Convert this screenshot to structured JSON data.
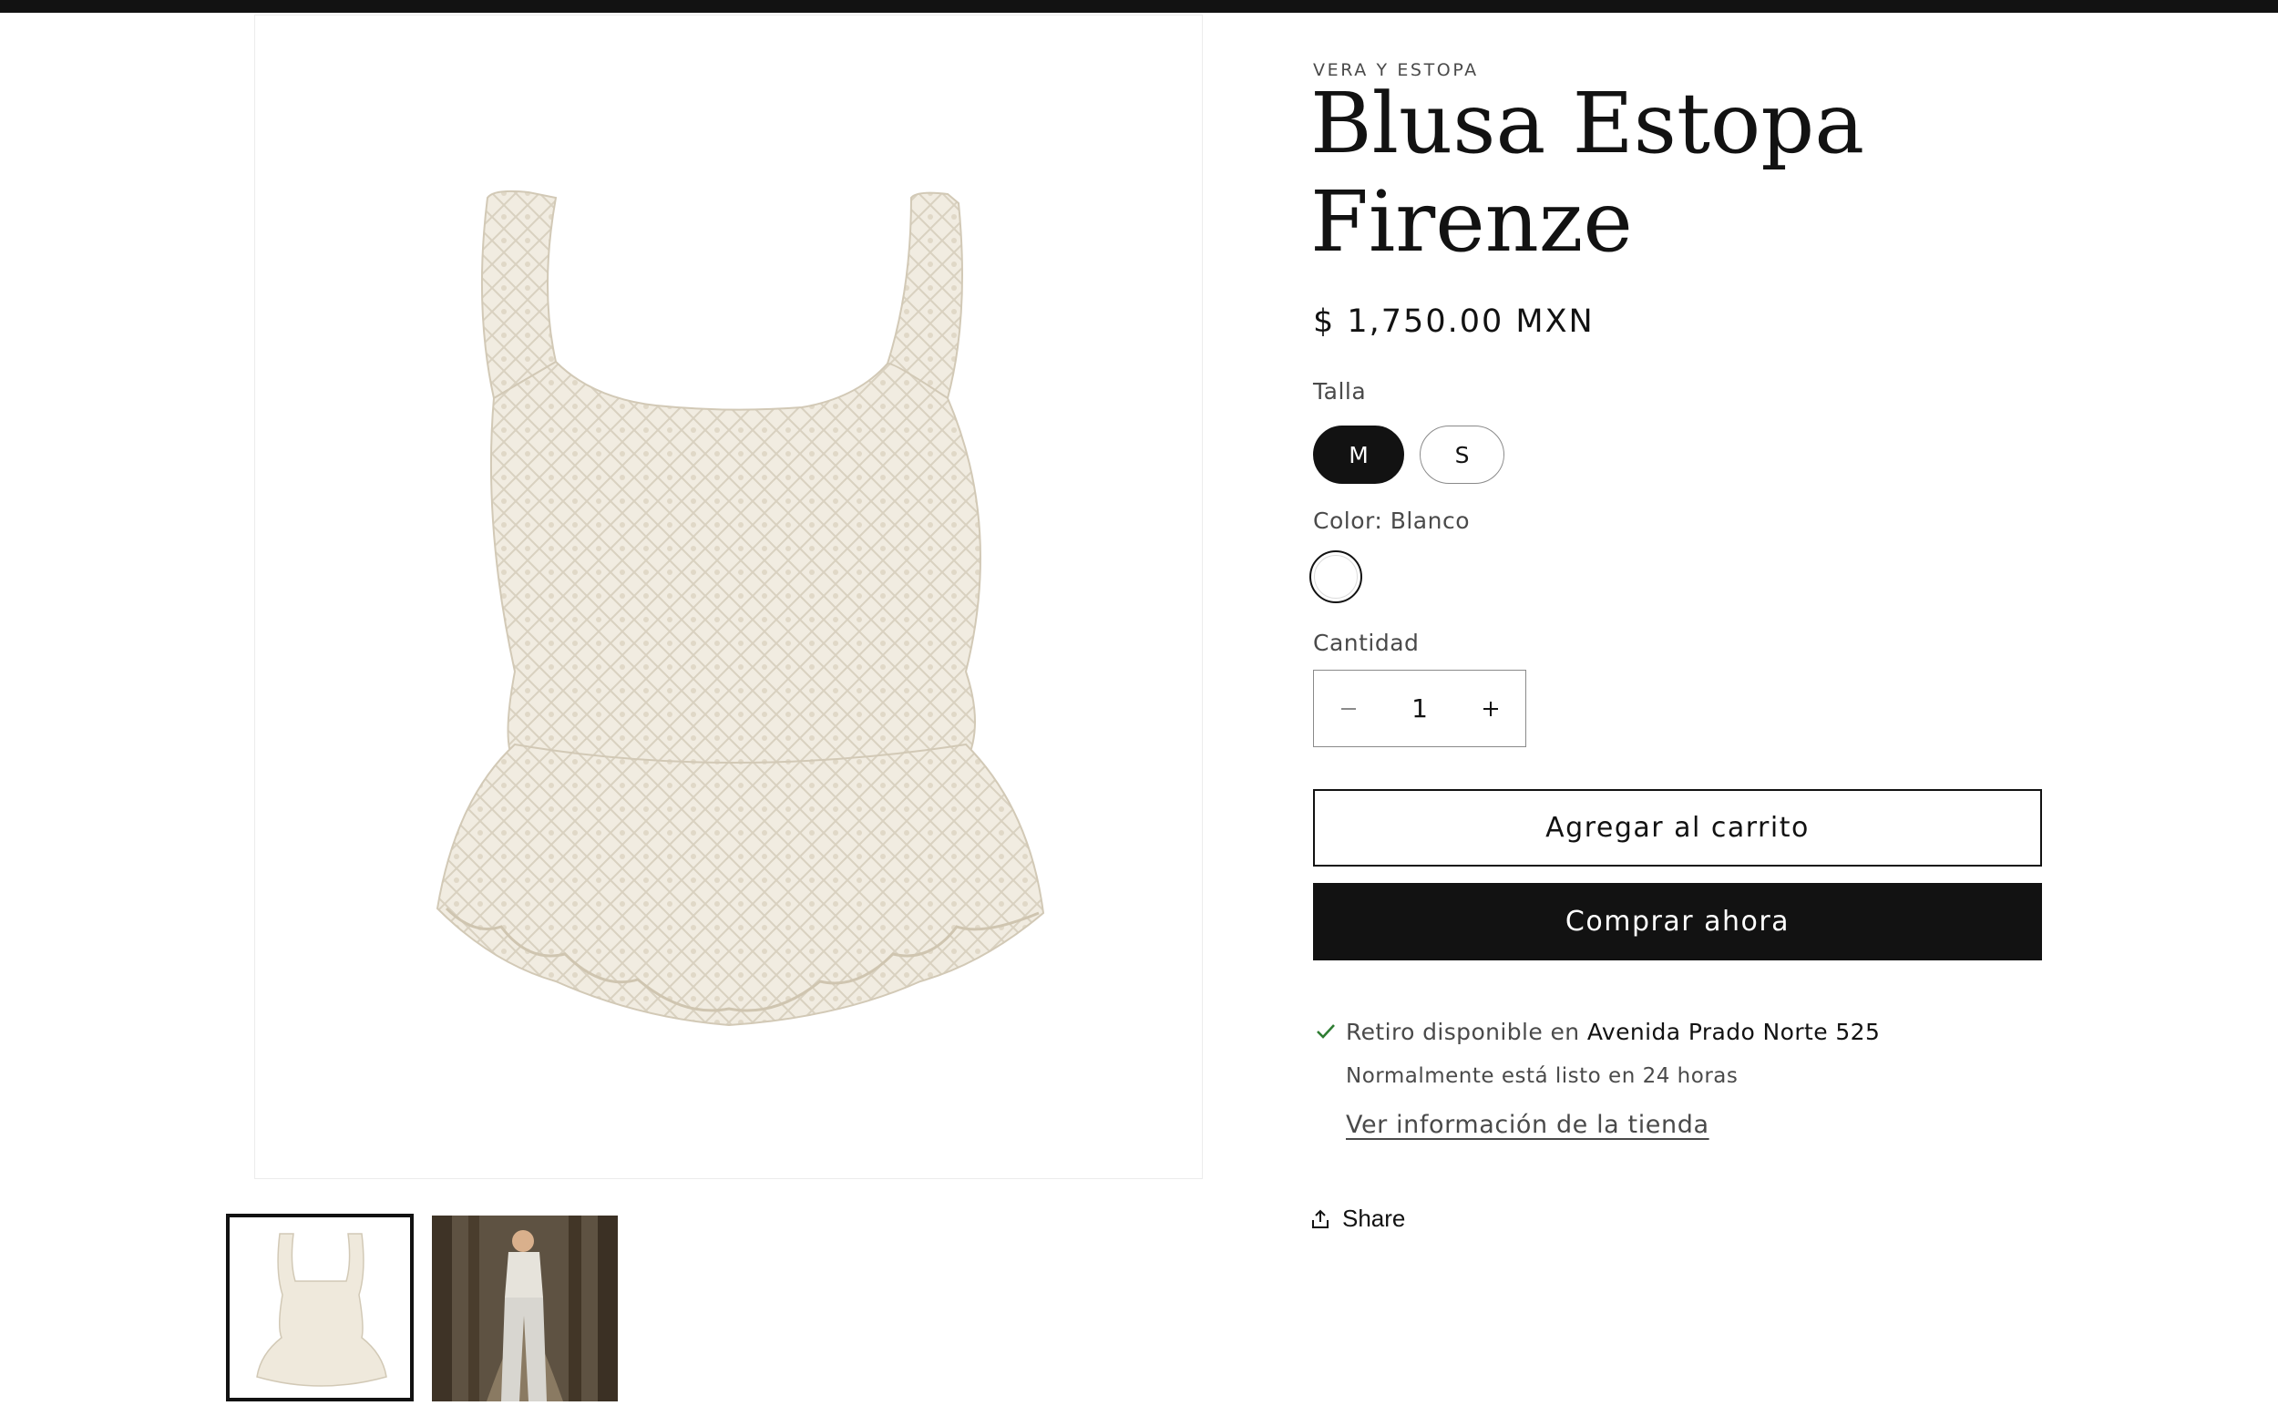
{
  "product": {
    "vendor": "VERA Y ESTOPA",
    "title": "Blusa Estopa Firenze",
    "price": "$ 1,750.00 MXN"
  },
  "size": {
    "label": "Talla",
    "options": [
      "M",
      "S"
    ],
    "selected": "M"
  },
  "color": {
    "label": "Color: Blanco",
    "swatch_hex": "#ffffff"
  },
  "quantity": {
    "label": "Cantidad",
    "value": "1",
    "decrement_icon": "minus-icon",
    "increment_icon": "plus-icon"
  },
  "actions": {
    "add_to_cart": "Agregar al carrito",
    "buy_now": "Comprar ahora"
  },
  "pickup": {
    "prefix": "Retiro disponible en",
    "location": "Avenida Prado Norte 525",
    "note": "Normalmente está listo en 24 horas",
    "link": "Ver información de la tienda"
  },
  "share": {
    "label": "Share",
    "icon": "share-icon"
  },
  "colors": {
    "text": "#121212",
    "muted": "#4a4a4a",
    "check": "#2e7d32",
    "garment": "#efe9dc"
  }
}
